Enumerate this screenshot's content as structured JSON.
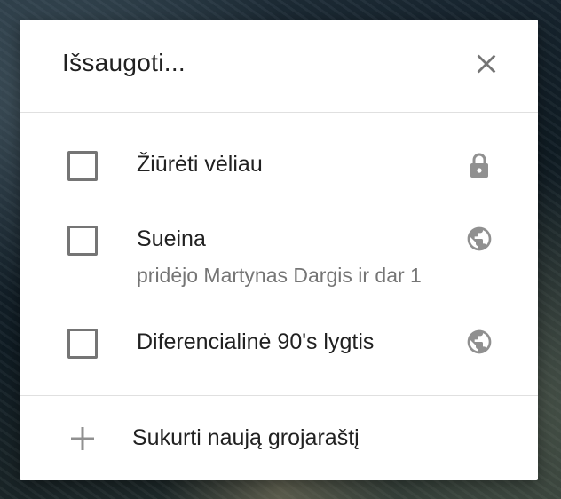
{
  "dialog": {
    "title": "Išsaugoti...",
    "close_icon": "close-icon",
    "playlists": [
      {
        "label": "Žiūrėti vėliau",
        "subtitle": "",
        "checked": false,
        "privacy_icon": "lock-icon"
      },
      {
        "label": "Sueina",
        "subtitle": "pridėjo Martynas Dargis ir dar 1",
        "checked": false,
        "privacy_icon": "globe-icon"
      },
      {
        "label": "Diferencialinė 90's lygtis",
        "subtitle": "",
        "checked": false,
        "privacy_icon": "globe-icon"
      }
    ],
    "create_label": "Sukurti naują grojaraštį",
    "create_icon": "plus-icon"
  },
  "colors": {
    "text_primary": "#212121",
    "text_secondary": "#757575",
    "icon": "#909090",
    "divider": "#e0e0e0"
  }
}
